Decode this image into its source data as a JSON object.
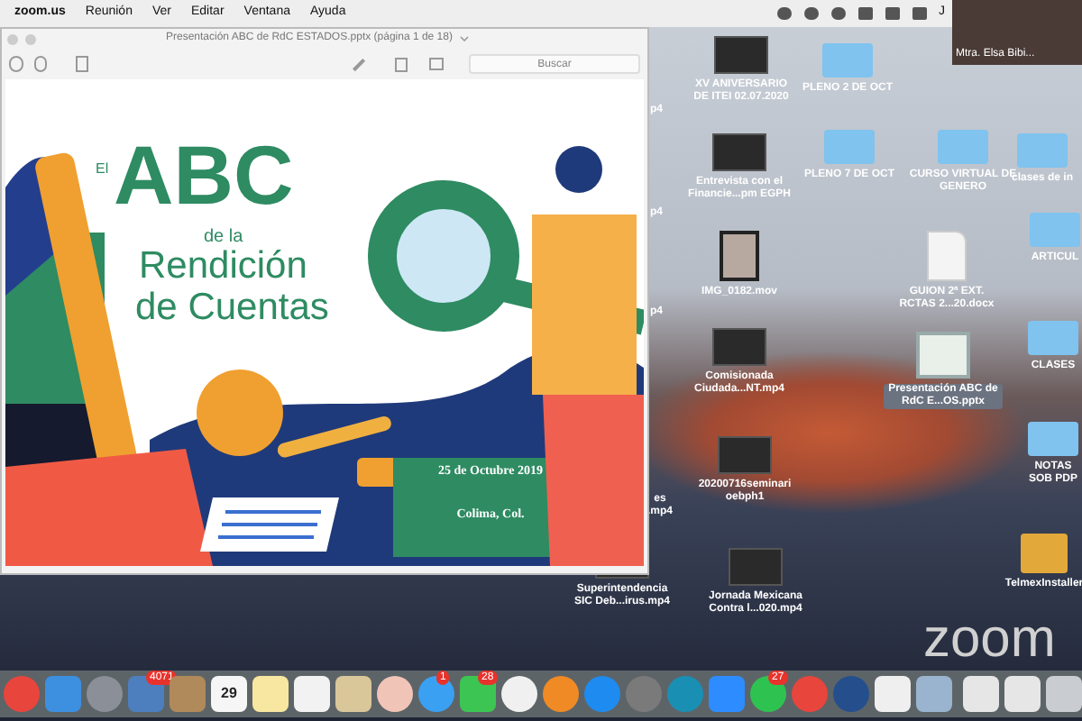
{
  "menu_bar": {
    "app": "zoom.us",
    "items": [
      "Reunión",
      "Ver",
      "Editar",
      "Ventana",
      "Ayuda"
    ],
    "user_initial": "J"
  },
  "video_tile": {
    "name": "Mtra. Elsa Bibi..."
  },
  "preview_window": {
    "title": "Presentación ABC de RdC ESTADOS.pptx (página 1 de 18)",
    "search": {
      "placeholder": "Buscar"
    },
    "slide": {
      "title_small": "El",
      "title_big": "ABC",
      "subtitle_1": "de la",
      "subtitle_2": "Rendición",
      "subtitle_3": "de Cuentas",
      "date": "25 de Octubre 2019",
      "place": "Colima, Col."
    }
  },
  "desktop_icons": [
    {
      "kind": "video",
      "label": "XV ANIVERSARIO DE ITEI 02.07.2020",
      "selected": false
    },
    {
      "kind": "folder",
      "label": "PLENO 2 DE OCT",
      "selected": false
    },
    {
      "kind": "video",
      "label": "Entrevista con el Financie...pm EGPH",
      "selected": false
    },
    {
      "kind": "folder",
      "label": "PLENO 7 DE OCT",
      "selected": false
    },
    {
      "kind": "folder",
      "label": "CURSO VIRTUAL DE GENERO",
      "selected": false
    },
    {
      "kind": "folder",
      "label": "clases de in",
      "selected": false
    },
    {
      "kind": "photo",
      "label": "IMG_0182.mov",
      "selected": false
    },
    {
      "kind": "doc",
      "label": "GUION 2ª EXT. RCTAS 2...20.docx",
      "selected": false
    },
    {
      "kind": "folder",
      "label": "ARTICUL",
      "selected": false
    },
    {
      "kind": "video",
      "label": "Comisionada Ciudada...NT.mp4",
      "selected": false
    },
    {
      "kind": "slides",
      "label": "Presentación ABC de RdC E...OS.pptx",
      "selected": true
    },
    {
      "kind": "folder",
      "label": "CLASES",
      "selected": false
    },
    {
      "kind": "video",
      "label": "20200716seminari oebph1",
      "selected": false
    },
    {
      "kind": "folder",
      "label": "NOTAS SOB PDP",
      "selected": false
    },
    {
      "kind": "video",
      "label": "Superintendencia SIC Deb...irus.mp4",
      "selected": false
    },
    {
      "kind": "video",
      "label": "Jornada Mexicana Contra l...020.mp4",
      "selected": false
    },
    {
      "kind": "package",
      "label": "TelmexInstaller",
      "selected": false
    },
    {
      "kind": "fragment",
      "label": "p4",
      "selected": false
    },
    {
      "kind": "fragment",
      "label": "p4",
      "selected": false
    },
    {
      "kind": "fragment",
      "label": "p4",
      "selected": false
    },
    {
      "kind": "fragment",
      "label": "es .mp4",
      "selected": false
    }
  ],
  "dock": [
    {
      "kind": "browser"
    },
    {
      "kind": "finder"
    },
    {
      "kind": "rocket"
    },
    {
      "kind": "mail",
      "badge": "4071"
    },
    {
      "kind": "contacts"
    },
    {
      "kind": "calendar",
      "date": "29"
    },
    {
      "kind": "notes"
    },
    {
      "kind": "list"
    },
    {
      "kind": "preview"
    },
    {
      "kind": "photos"
    },
    {
      "kind": "messages",
      "badge": "1"
    },
    {
      "kind": "facetime",
      "badge": "28"
    },
    {
      "kind": "music"
    },
    {
      "kind": "books"
    },
    {
      "kind": "store"
    },
    {
      "kind": "settings"
    },
    {
      "kind": "webex"
    },
    {
      "kind": "camera"
    },
    {
      "kind": "whatsapp",
      "badge": "27"
    },
    {
      "kind": "browser"
    },
    {
      "kind": "quicktime"
    },
    {
      "kind": "paper"
    },
    {
      "kind": "pictures"
    },
    {
      "kind": "divider"
    },
    {
      "kind": "document"
    },
    {
      "kind": "document"
    },
    {
      "kind": "trash"
    }
  ],
  "watermark_logo": "zoom"
}
